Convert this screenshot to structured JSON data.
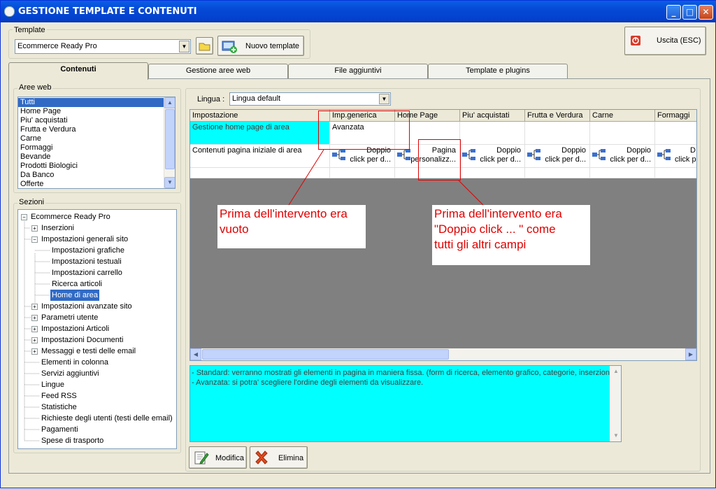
{
  "window": {
    "title": "GESTIONE TEMPLATE E CONTENUTI",
    "min": "_",
    "max": "□",
    "close": "✕"
  },
  "template_group": {
    "label": "Template",
    "selected": "Ecommerce Ready Pro",
    "new_button": "Nuovo template"
  },
  "exit_button": "Uscita (ESC)",
  "tabs": [
    "Contenuti",
    "Gestione aree web",
    "File aggiuntivi",
    "Template e plugins"
  ],
  "aree_web": {
    "label": "Aree web",
    "items": [
      "Tutti",
      "Home Page",
      "Piu' acquistati",
      "Frutta e Verdura",
      "Carne",
      "Formaggi",
      "Bevande",
      "Prodotti Biologici",
      "Da Banco",
      "Offerte"
    ]
  },
  "sezioni": {
    "label": "Sezioni",
    "root": "Ecommerce Ready Pro",
    "items": [
      "Inserzioni",
      "Impostazioni generali sito",
      "Impostazioni grafiche",
      "Impostazioni testuali",
      "Impostazioni carrello",
      "Ricerca articoli",
      "Home di area",
      "Impostazioni avanzate sito",
      "Parametri utente",
      "Impostazioni Articoli",
      "Impostazioni Documenti",
      "Messaggi e testi delle email",
      "Elementi in colonna",
      "Servizi aggiuntivi",
      "Lingue",
      "Feed RSS",
      "Statistiche",
      "Richieste degli utenti (testi delle email)",
      "Pagamenti",
      "Spese di trasporto"
    ]
  },
  "lingua": {
    "label": "Lingua :",
    "selected": "Lingua default"
  },
  "grid": {
    "headers": [
      "Impostazione",
      "Imp.generica",
      "Home Page",
      "Piu' acquistati",
      "Frutta e Verdura",
      "Carne",
      "Formaggi"
    ],
    "row1": {
      "label": "Gestione home page di area",
      "value": "Avanzata"
    },
    "row2": {
      "label": "Contenuti pagina iniziale di area",
      "cells": [
        {
          "l1": "Doppio",
          "l2": "click per d..."
        },
        {
          "l1": "Pagina",
          "l2": "personalizz..."
        },
        {
          "l1": "Doppio",
          "l2": "click per d..."
        },
        {
          "l1": "Doppio",
          "l2": "click per d..."
        },
        {
          "l1": "Doppio",
          "l2": "click per d..."
        },
        {
          "l1": "D",
          "l2": "click p"
        }
      ]
    }
  },
  "description": [
    "- Standard: verranno mostrati gli elementi in pagina in maniera fissa. (form di ricerca, elemento grafico, categorie, inserzioni)",
    "- Avanzata: si potra' scegliere l'ordine degli elementi da visualizzare."
  ],
  "annotations": {
    "left": [
      "Prima dell'intervento era",
      "vuoto"
    ],
    "right": [
      "Prima dell'intervento era",
      "\"Doppio click ... \" come",
      "tutti gli altri campi"
    ]
  },
  "buttons": {
    "modifica": "Modifica",
    "elimina": "Elimina"
  },
  "colors": {
    "highlight_cell": "#00ffff",
    "selection": "#316ac5",
    "annotation": "#e00000"
  }
}
